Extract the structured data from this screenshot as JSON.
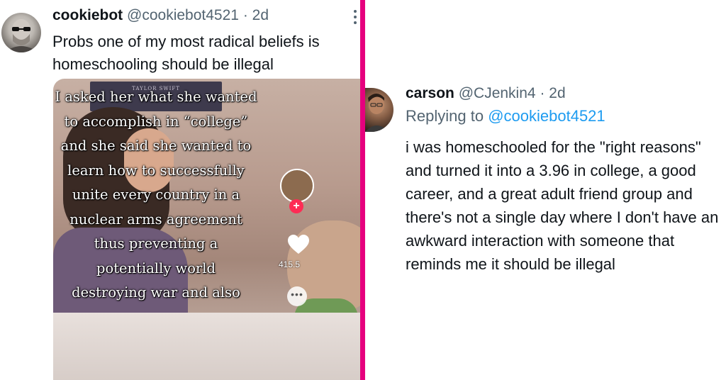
{
  "left_tweet": {
    "author_name": "cookiebot",
    "handle": "@cookiebot4521",
    "separator": "·",
    "time": "2d",
    "text": "Probs one of my most radical beliefs is homeschooling should be illegal",
    "media": {
      "wall_sign": "TAYLOR SWIFT",
      "caption_lines": [
        "I asked her what she wanted",
        "to accomplish in “college”",
        "and she said she wanted to",
        "learn how to successfully",
        "unite every country in a",
        "nuclear arms agreement",
        "thus preventing a",
        "potentially world",
        "destroying war and also"
      ],
      "like_count": "415.5",
      "plus_glyph": "+",
      "more_glyph": "•••"
    }
  },
  "right_tweet": {
    "author_name": "carson",
    "handle": "@CJenkin4",
    "separator": "·",
    "time": "2d",
    "replying_label": "Replying to",
    "replying_to": "@cookiebot4521",
    "text": "i was homeschooled for the \"right reasons\" and turned it into a 3.96 in college, a good career, and a great adult friend group and there's not a single day where I don't have an awkward interaction with someone that reminds me it should be illegal"
  },
  "colors": {
    "divider": "#e6007e",
    "text_primary": "#0f1419",
    "text_secondary": "#536471",
    "link": "#1d9bf0",
    "tiktok_red": "#fe2c55"
  }
}
